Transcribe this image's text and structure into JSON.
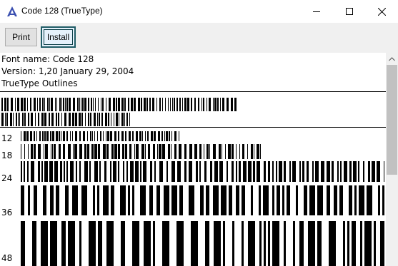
{
  "window": {
    "title": "Code 128 (TrueType)"
  },
  "toolbar": {
    "print_label": "Print",
    "install_label": "Install"
  },
  "font_info": {
    "name_line": "Font name: Code 128",
    "version_line": "Version: 1,20 January 29, 2004",
    "outline_line": "TrueType Outlines"
  },
  "samples": {
    "sizes": [
      "12",
      "18",
      "24",
      "36",
      "48"
    ]
  },
  "icons": {
    "app": "font-viewer-icon",
    "minimize": "minimize-icon",
    "maximize": "maximize-icon",
    "close": "close-icon",
    "scroll_up": "scroll-up-arrow-icon"
  },
  "colors": {
    "install_border": "#1f5c66",
    "toolbar_bg": "#f0f0f0"
  }
}
